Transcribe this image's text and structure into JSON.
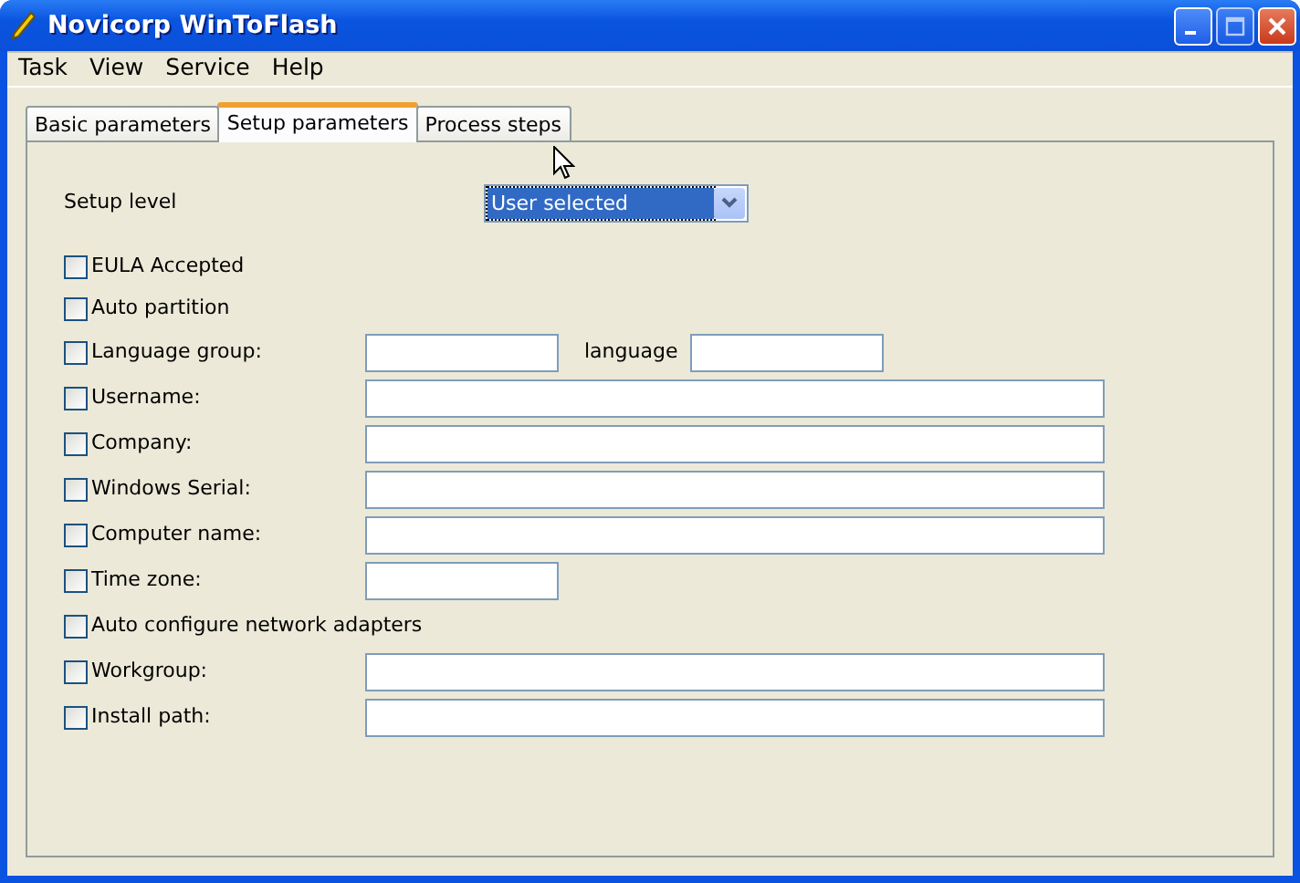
{
  "window": {
    "title": "Novicorp WinToFlash"
  },
  "menu": [
    "Task",
    "View",
    "Service",
    "Help"
  ],
  "tabs": [
    {
      "label": "Basic parameters",
      "selected": false
    },
    {
      "label": "Setup parameters",
      "selected": true
    },
    {
      "label": "Process steps",
      "selected": false
    }
  ],
  "setup_level": {
    "label": "Setup level",
    "value": "User selected"
  },
  "fields": [
    {
      "label": "EULA Accepted",
      "checked": false,
      "kind": "none"
    },
    {
      "label": "Auto partition",
      "checked": false,
      "kind": "none"
    },
    {
      "label": "Language group:",
      "checked": false,
      "kind": "pair",
      "second_label": "language"
    },
    {
      "label": "Username:",
      "checked": false,
      "kind": "long"
    },
    {
      "label": "Company:",
      "checked": false,
      "kind": "long"
    },
    {
      "label": "Windows Serial:",
      "checked": false,
      "kind": "long"
    },
    {
      "label": "Computer name:",
      "checked": false,
      "kind": "long"
    },
    {
      "label": "Time zone:",
      "checked": false,
      "kind": "short"
    },
    {
      "label": "Auto configure network adapters",
      "checked": false,
      "kind": "none"
    },
    {
      "label": "Workgroup:",
      "checked": false,
      "kind": "long"
    },
    {
      "label": "Install path:",
      "checked": false,
      "kind": "long"
    }
  ]
}
